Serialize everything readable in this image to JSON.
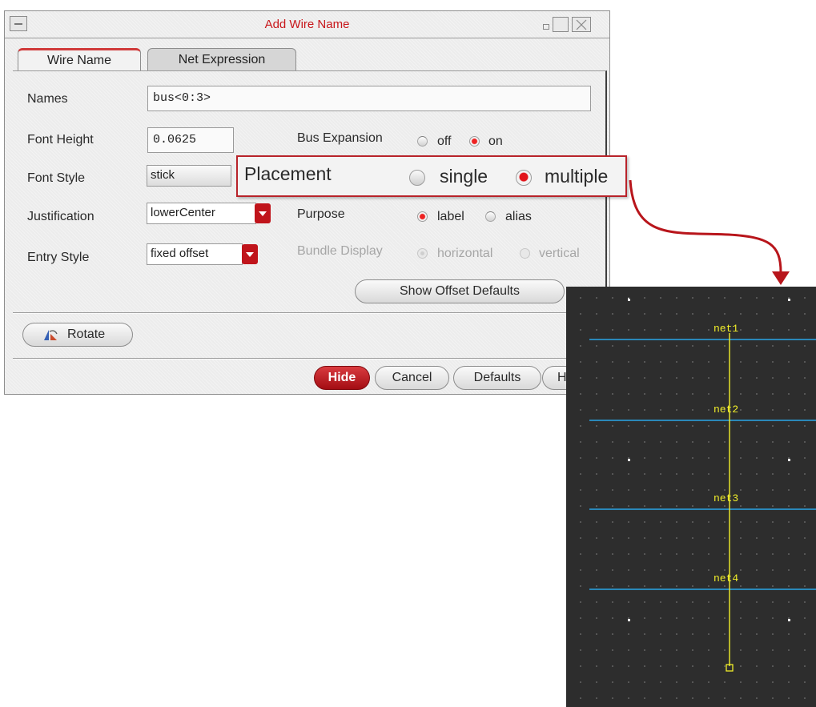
{
  "dialog": {
    "title": "Add Wire Name",
    "tabs": [
      {
        "label": "Wire Name",
        "active": true
      },
      {
        "label": "Net Expression",
        "active": false
      }
    ],
    "names": {
      "label": "Names",
      "value": "bus<0:3>"
    },
    "font_height": {
      "label": "Font Height",
      "value": "0.0625"
    },
    "bus_expansion": {
      "label": "Bus Expansion",
      "options": [
        "off",
        "on"
      ],
      "selected": "on"
    },
    "font_style": {
      "label": "Font Style",
      "value": "stick"
    },
    "placement": {
      "label": "Placement",
      "options": [
        "single",
        "multiple"
      ],
      "selected": "multiple"
    },
    "justification": {
      "label": "Justification",
      "value": "lowerCenter"
    },
    "purpose": {
      "label": "Purpose",
      "options": [
        "label",
        "alias"
      ],
      "selected": "label"
    },
    "entry_style": {
      "label": "Entry Style",
      "value": "fixed offset"
    },
    "bundle_display": {
      "label": "Bundle Display",
      "options": [
        "horizontal",
        "vertical"
      ],
      "selected": "horizontal",
      "enabled": false
    },
    "show_offset_defaults": "Show Offset Defaults",
    "rotate": "Rotate",
    "buttons": {
      "hide": "Hide",
      "cancel": "Cancel",
      "defaults": "Defaults",
      "help": "H"
    }
  },
  "schematic": {
    "net_labels": [
      "net1",
      "net2",
      "net3",
      "net4"
    ]
  },
  "colors": {
    "accent_red": "#c0141b",
    "title_red": "#c8161a",
    "net_wire": "#2aa7e8",
    "bus_wire": "#f2ef2a",
    "schematic_bg": "#2d2d2d"
  }
}
